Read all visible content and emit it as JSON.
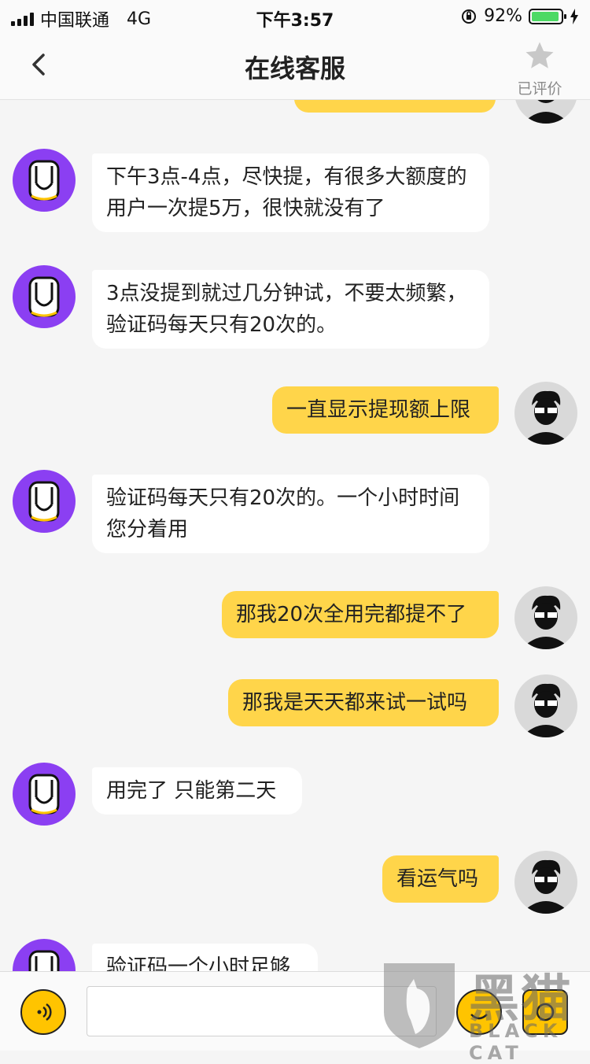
{
  "status_bar": {
    "carrier": "中国联通",
    "network": "4G",
    "time": "下午3:57",
    "battery_pct": "92%"
  },
  "nav": {
    "title": "在线客服",
    "rate_label": "已评价"
  },
  "messages": [
    {
      "from": "user",
      "text": ""
    },
    {
      "from": "agent",
      "text": "下午3点-4点，尽快提，有很多大额度的用户一次提5万，很快就没有了"
    },
    {
      "from": "agent",
      "text": "3点没提到就过几分钟试，不要太频繁，验证码每天只有20次的。"
    },
    {
      "from": "user",
      "text": "一直显示提现额上限"
    },
    {
      "from": "agent",
      "text": "验证码每天只有20次的。一个小时时间您分着用"
    },
    {
      "from": "user",
      "text": "那我20次全用完都提不了"
    },
    {
      "from": "user",
      "text": "那我是天天都来试一试吗"
    },
    {
      "from": "agent",
      "text": "用完了 只能第二天"
    },
    {
      "from": "user",
      "text": "看运气吗"
    },
    {
      "from": "agent",
      "text": "验证码一个小时足够"
    }
  ],
  "watermark": {
    "cn": "黑猫",
    "en": "BLACK CAT"
  },
  "colors": {
    "user_bubble": "#ffd54a",
    "agent_bubble": "#ffffff",
    "agent_avatar": "#8b3ff2",
    "background": "#f5f5f5"
  }
}
